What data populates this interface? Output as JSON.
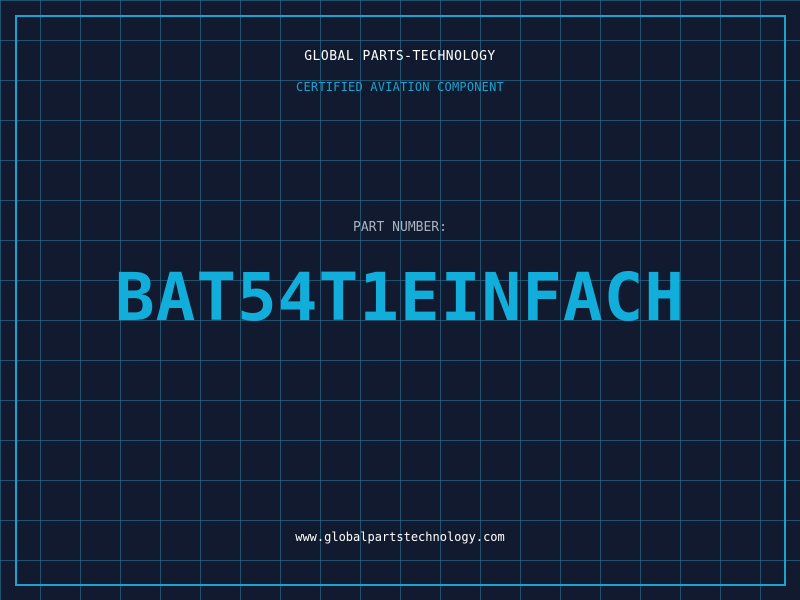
{
  "company_name": "GLOBAL PARTS-TECHNOLOGY",
  "tagline": "CERTIFIED AVIATION COMPONENT",
  "part_number_label": "PART NUMBER:",
  "part_number": "BAT54T1EINFACH",
  "website": "www.globalpartstechnology.com",
  "colors": {
    "background": "#111a2e",
    "grid": "#2680a8",
    "accent": "#12aedb",
    "label": "#a9b3c1",
    "text": "#ffffff"
  }
}
